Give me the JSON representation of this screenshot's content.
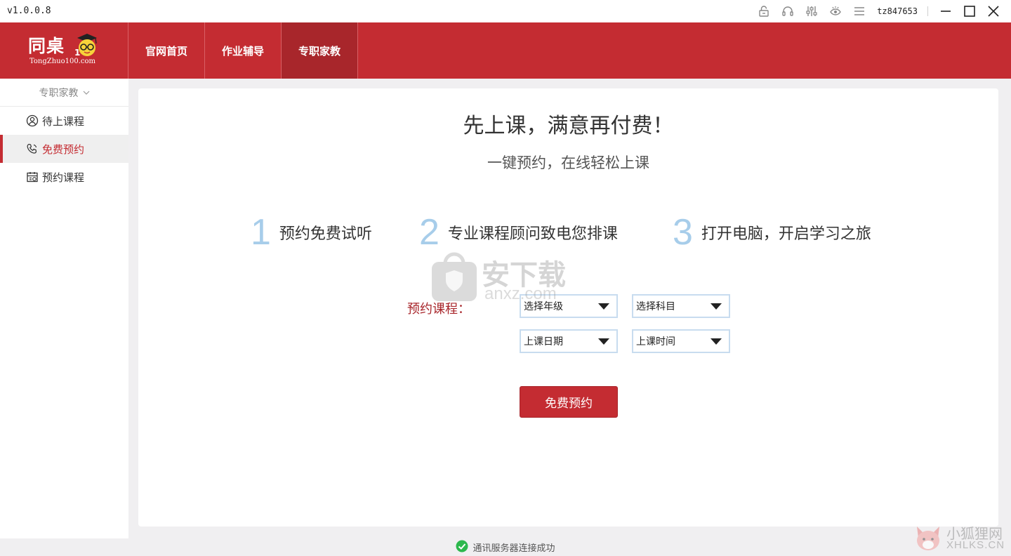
{
  "app": {
    "version": "v1.0.0.8",
    "username": "tz847653"
  },
  "logo": {
    "cn": "同桌",
    "en": "TongZhuo100.com"
  },
  "nav": {
    "items": [
      {
        "label": "官网首页"
      },
      {
        "label": "作业辅导"
      },
      {
        "label": "专职家教"
      }
    ],
    "active_index": 2
  },
  "sidebar": {
    "header": "专职家教",
    "items": [
      {
        "label": "待上课程",
        "icon": "user-circle-icon"
      },
      {
        "label": "免费预约",
        "icon": "phone-icon"
      },
      {
        "label": "预约课程",
        "icon": "calendar-icon"
      }
    ],
    "active_index": 1
  },
  "main": {
    "title": "先上课，满意再付费！",
    "subtitle": "一键预约，在线轻松上课",
    "steps": [
      {
        "number": "1",
        "text": "预约免费试听"
      },
      {
        "number": "2",
        "text": "专业课程顾问致电您排课"
      },
      {
        "number": "3",
        "text": "打开电脑，开启学习之旅"
      }
    ],
    "form": {
      "label": "预约课程：",
      "grade_select": "选择年级",
      "subject_select": "选择科目",
      "date_select": "上课日期",
      "time_select": "上课时间",
      "submit_label": "免费预约"
    }
  },
  "watermarks": {
    "anxz": {
      "text": "安下载",
      "sub": "anxz.com"
    },
    "xhlks": {
      "text": "小狐狸网",
      "sub": "XHLKS.CN"
    }
  },
  "status": {
    "text": "通讯服务器连接成功",
    "color": "#2db84d"
  },
  "colors": {
    "brand_red": "#c42c32",
    "step_blue": "#a7cdea"
  }
}
